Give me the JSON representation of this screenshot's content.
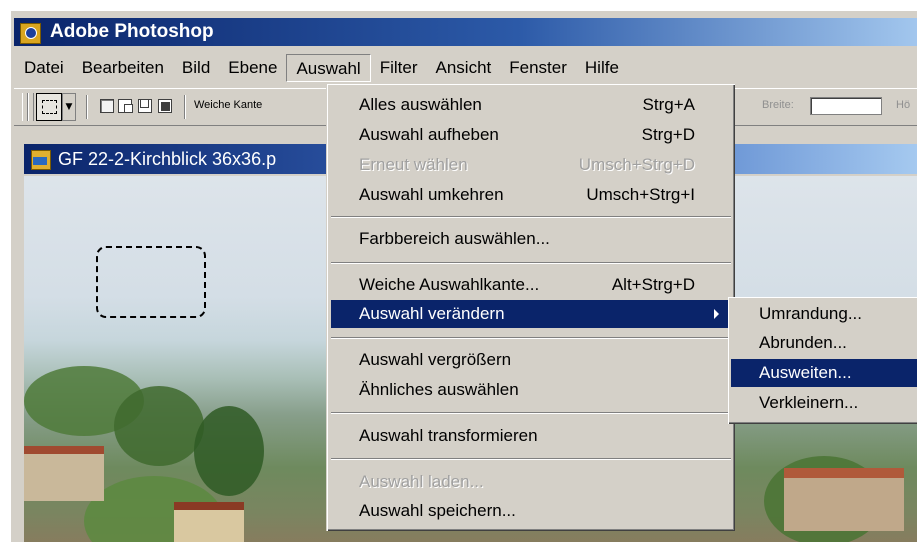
{
  "app": {
    "title": "Adobe Photoshop"
  },
  "menubar": {
    "items": [
      "Datei",
      "Bearbeiten",
      "Bild",
      "Ebene",
      "Auswahl",
      "Filter",
      "Ansicht",
      "Fenster",
      "Hilfe"
    ],
    "active": "Auswahl"
  },
  "toolbar": {
    "feather_label": "Weiche Kante",
    "width_label": "Breite:",
    "height_label": "Hö"
  },
  "document": {
    "title": "GF 22-2-Kirchblick 36x36.p"
  },
  "auswahl_menu": {
    "items": [
      {
        "label": "Alles auswählen",
        "shortcut": "Strg+A",
        "state": "enabled"
      },
      {
        "label": "Auswahl aufheben",
        "shortcut": "Strg+D",
        "state": "enabled"
      },
      {
        "label": "Erneut wählen",
        "shortcut": "Umsch+Strg+D",
        "state": "disabled"
      },
      {
        "label": "Auswahl umkehren",
        "shortcut": "Umsch+Strg+I",
        "state": "enabled"
      },
      {
        "label": "Farbbereich auswählen...",
        "shortcut": "",
        "state": "enabled"
      },
      {
        "label": "Weiche Auswahlkante...",
        "shortcut": "Alt+Strg+D",
        "state": "enabled"
      },
      {
        "label": "Auswahl verändern",
        "shortcut": "",
        "state": "highlighted",
        "has_submenu": true
      },
      {
        "label": "Auswahl vergrößern",
        "shortcut": "",
        "state": "enabled"
      },
      {
        "label": "Ähnliches auswählen",
        "shortcut": "",
        "state": "enabled"
      },
      {
        "label": "Auswahl transformieren",
        "shortcut": "",
        "state": "enabled"
      },
      {
        "label": "Auswahl laden...",
        "shortcut": "",
        "state": "disabled"
      },
      {
        "label": "Auswahl speichern...",
        "shortcut": "",
        "state": "enabled"
      }
    ]
  },
  "submenu": {
    "items": [
      {
        "label": "Umrandung...",
        "state": "enabled"
      },
      {
        "label": "Abrunden...",
        "state": "enabled"
      },
      {
        "label": "Ausweiten...",
        "state": "highlighted"
      },
      {
        "label": "Verkleinern...",
        "state": "enabled"
      }
    ]
  },
  "colors": {
    "title_bar": "#0a246a",
    "menu_highlight": "#0a246a",
    "window_face": "#d4d0c8"
  }
}
